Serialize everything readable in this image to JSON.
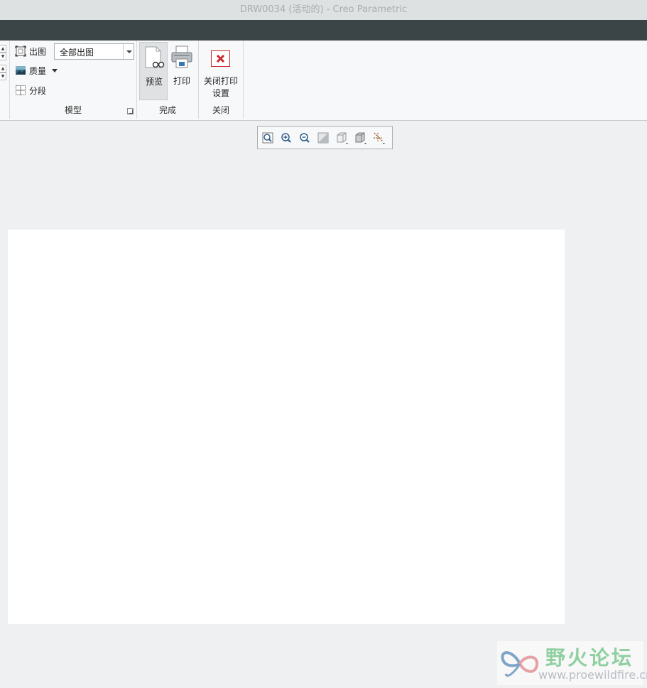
{
  "window": {
    "title": "DRW0034 (活动的) - Creo Parametric"
  },
  "ribbon": {
    "model_group": {
      "label": "模型",
      "output_label": "出图",
      "quality_label": "质量",
      "segment_label": "分段",
      "output_select_value": "全部出图"
    },
    "finish_group": {
      "label": "完成",
      "preview_label": "预览",
      "print_label": "打印"
    },
    "close_group": {
      "label": "关闭",
      "close_print_settings_label_line1": "关闭打印",
      "close_print_settings_label_line2": "设置"
    }
  },
  "view_toolbar": {
    "buttons": [
      "zoom-fit-icon",
      "zoom-in-icon",
      "zoom-out-icon",
      "refit-icon",
      "saved-views-icon",
      "display-style-icon",
      "datum-display-icon"
    ]
  },
  "watermark": {
    "title": "野火论坛",
    "url": "www.proewildfire.cn"
  },
  "colors": {
    "titlebar": "#dde1e2",
    "darkband": "#3b4446",
    "ribbon": "#f7f8f9",
    "workspace": "#eff0f1",
    "close_red": "#d0252b"
  }
}
